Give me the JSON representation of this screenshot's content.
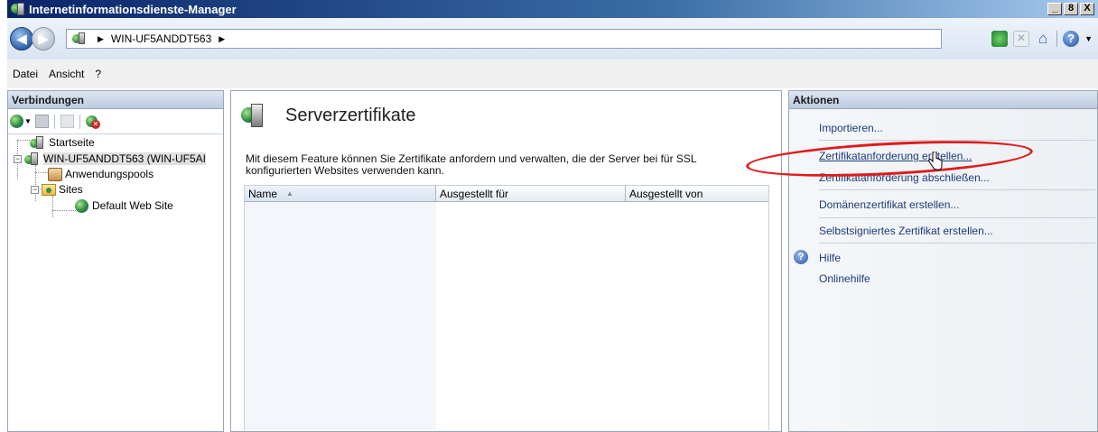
{
  "window": {
    "title": "Internetinformationsdienste-Manager",
    "controls": [
      "_",
      "8",
      "X"
    ]
  },
  "address": {
    "path": "WIN-UF5ANDDT563",
    "sep": "▶"
  },
  "menu": [
    "Datei",
    "Ansicht",
    "?"
  ],
  "connections": {
    "header": "Verbindungen",
    "tree": {
      "startseite": "Startseite",
      "server": "WIN-UF5ANDDT563 (WIN-UF5AI",
      "app_pools": "Anwendungspools",
      "sites": "Sites",
      "default_site": "Default Web Site"
    }
  },
  "main": {
    "title": "Serverzertifikate",
    "description": "Mit diesem Feature können Sie Zertifikate anfordern und verwalten, die der Server bei für SSL konfigurierten Websites verwenden kann.",
    "columns": [
      "Name",
      "Ausgestellt für",
      "Ausgestellt von"
    ]
  },
  "actions": {
    "header": "Aktionen",
    "items": [
      "Importieren...",
      "Zertifikatanforderung erstellen...",
      "Zertifikatanforderung abschließen...",
      "Domänenzertifikat erstellen...",
      "Selbstsigniertes Zertifikat erstellen..."
    ],
    "help": "Hilfe",
    "online_help": "Onlinehilfe"
  },
  "colors": {
    "highlight": "#e01b1b",
    "link": "#1a3b7a"
  }
}
